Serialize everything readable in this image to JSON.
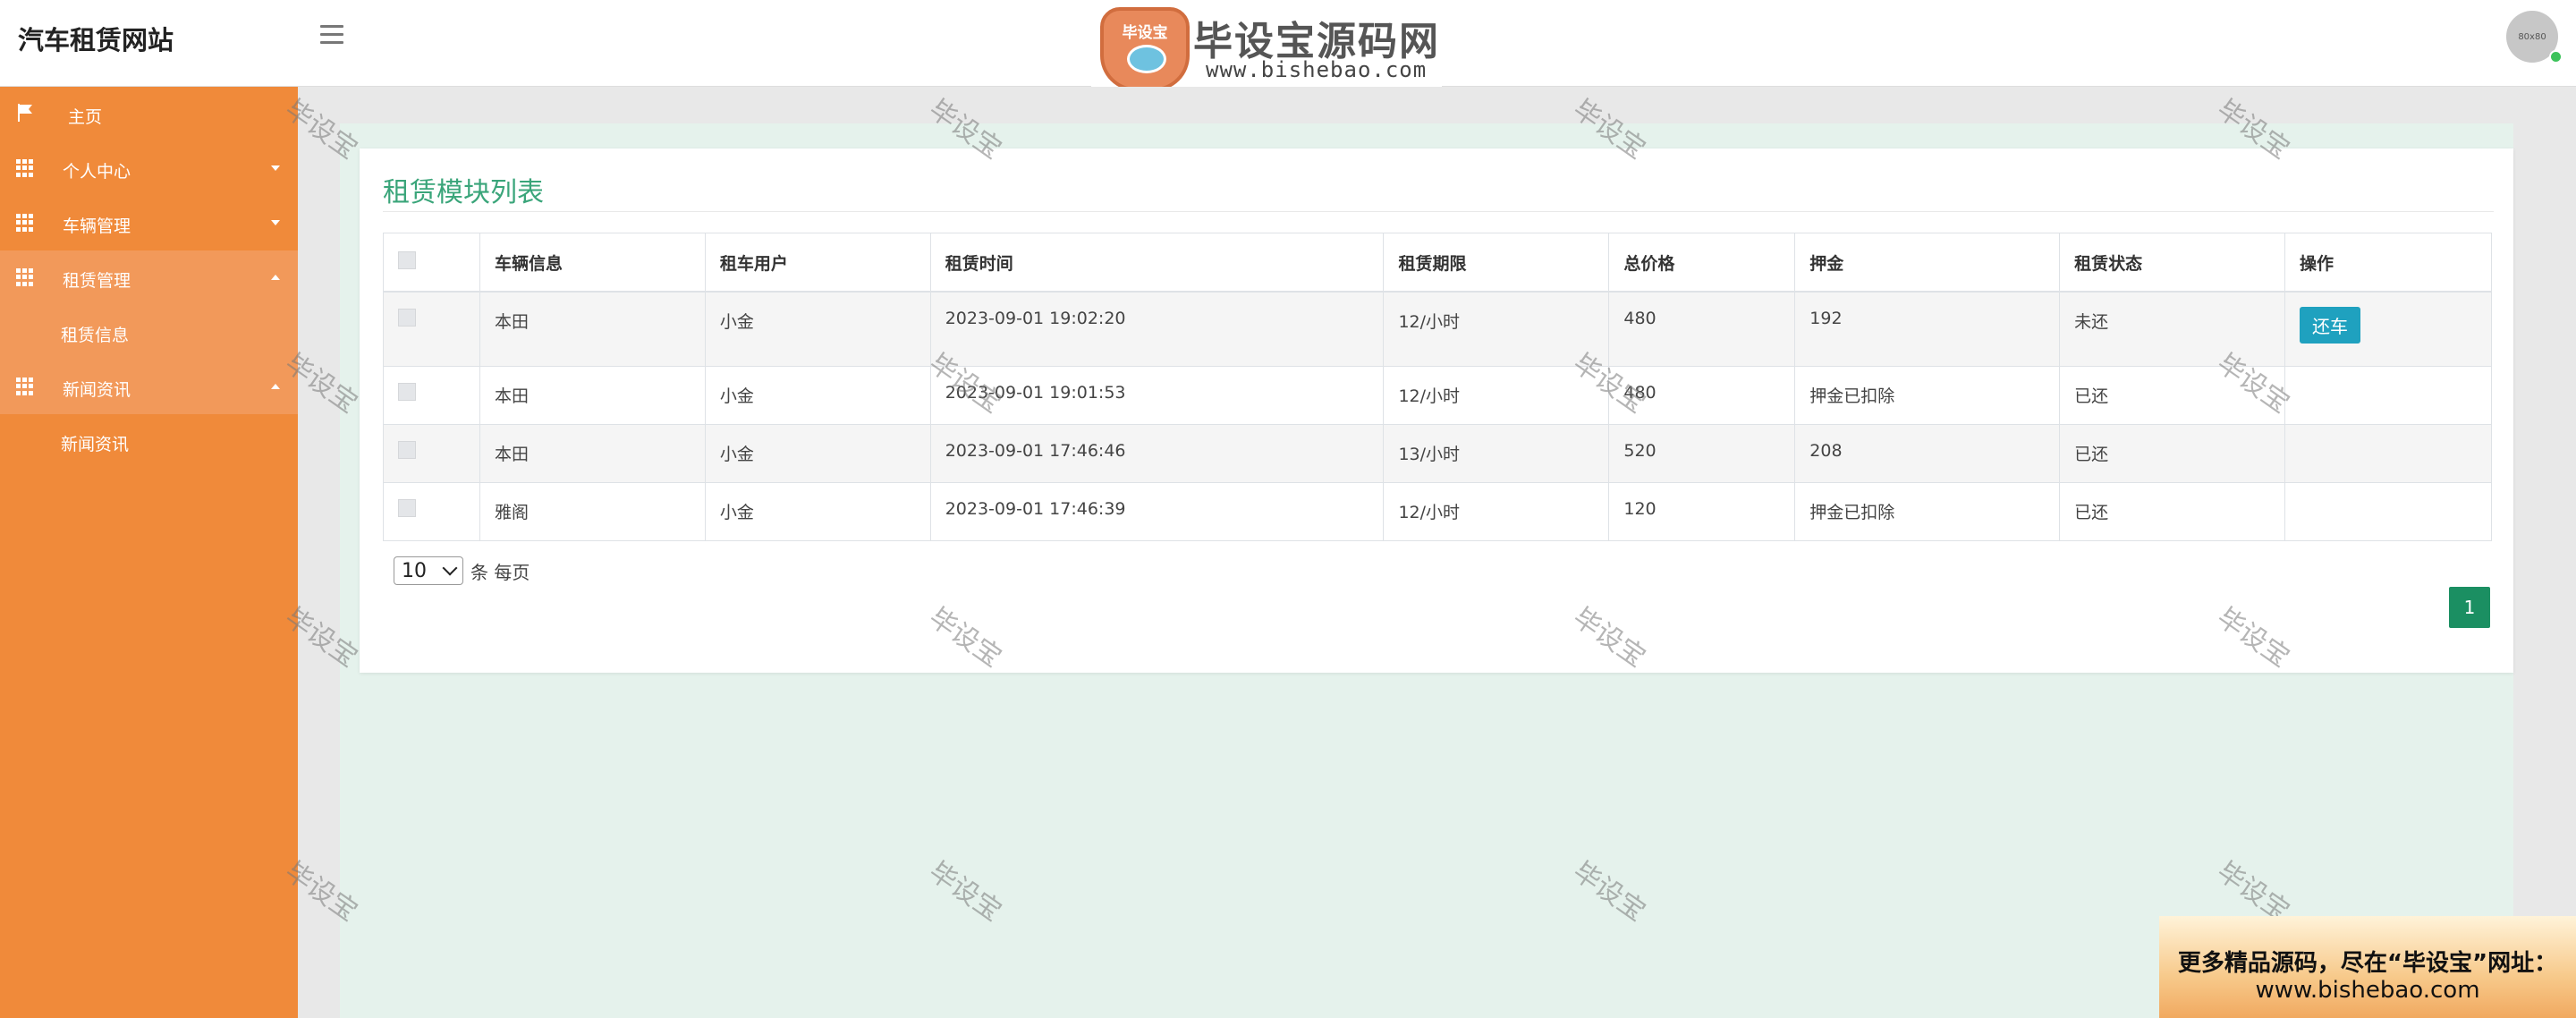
{
  "app": {
    "title": "汽车租赁网站"
  },
  "logo": {
    "badge": "毕设宝",
    "title": "毕设宝源码网",
    "url": "www.bishebao.com"
  },
  "avatar": {
    "label": "80x80"
  },
  "sidebar": {
    "items": [
      {
        "label": "主页",
        "icon": "flag-icon"
      },
      {
        "label": "个人中心",
        "icon": "grid-icon"
      },
      {
        "label": "车辆管理",
        "icon": "grid-icon"
      },
      {
        "label": "租赁管理",
        "icon": "grid-icon",
        "sub": "租赁信息"
      },
      {
        "label": "新闻资讯",
        "icon": "grid-icon",
        "sub": "新闻资讯"
      }
    ]
  },
  "main": {
    "title": "租赁模块列表",
    "columns": [
      "车辆信息",
      "租车用户",
      "租赁时间",
      "租赁期限",
      "总价格",
      "押金",
      "租赁状态",
      "操作"
    ],
    "rows": [
      {
        "car": "本田",
        "user": "小金",
        "time": "2023-09-01 19:02:20",
        "term": "12/小时",
        "price": "480",
        "deposit": "192",
        "status": "未还",
        "action": "还车"
      },
      {
        "car": "本田",
        "user": "小金",
        "time": "2023-09-01 19:01:53",
        "term": "12/小时",
        "price": "480",
        "deposit": "押金已扣除",
        "status": "已还",
        "action": ""
      },
      {
        "car": "本田",
        "user": "小金",
        "time": "2023-09-01 17:46:46",
        "term": "13/小时",
        "price": "520",
        "deposit": "208",
        "status": "已还",
        "action": ""
      },
      {
        "car": "雅阁",
        "user": "小金",
        "time": "2023-09-01 17:46:39",
        "term": "12/小时",
        "price": "120",
        "deposit": "押金已扣除",
        "status": "已还",
        "action": ""
      }
    ],
    "page_size": "10",
    "page_size_label": "条 每页",
    "current_page": "1"
  },
  "watermark": "毕设宝",
  "ad": {
    "line1": "更多精品源码，尽在“毕设宝”网址：",
    "line2": "www.bishebao.com"
  },
  "colors": {
    "sidebar": "#f08a3a",
    "accent": "#3aa57a",
    "button": "#1fa1bf",
    "pager": "#1b8f62"
  }
}
